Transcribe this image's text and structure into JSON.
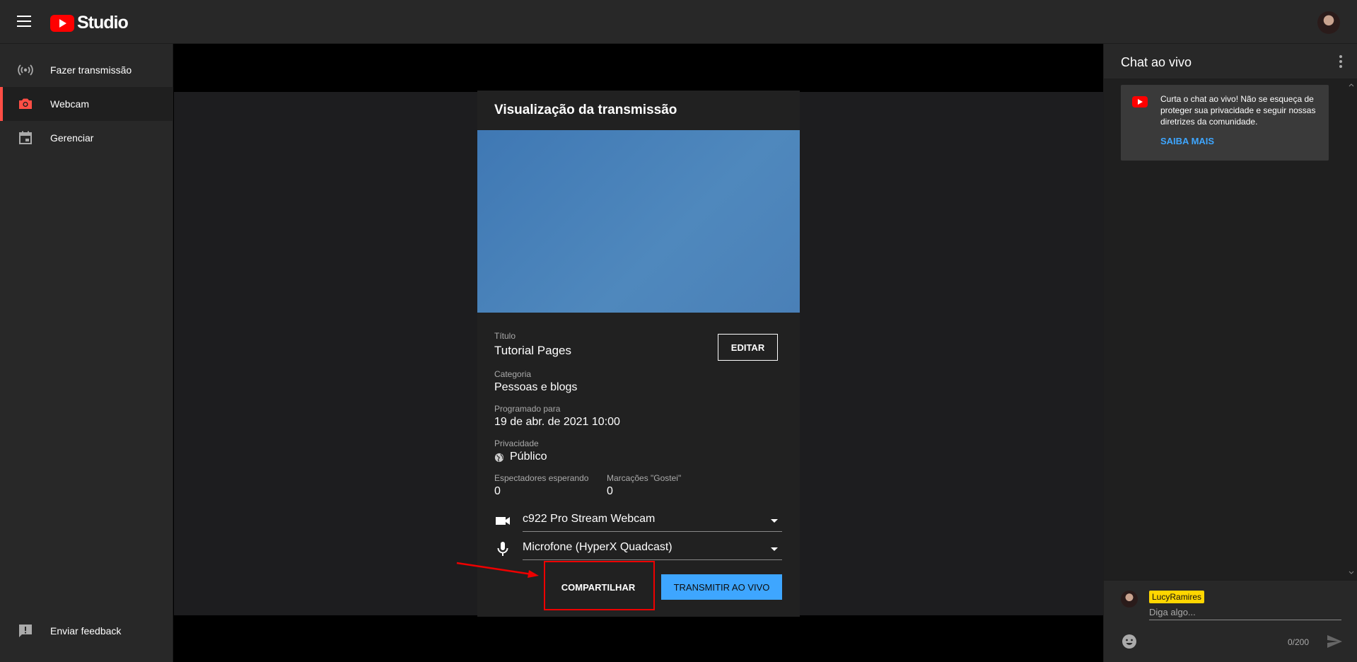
{
  "header": {
    "logo_text": "Studio"
  },
  "sidebar": {
    "items": [
      {
        "label": "Fazer transmissão",
        "icon": "broadcast-icon"
      },
      {
        "label": "Webcam",
        "icon": "camera-icon",
        "active": true
      },
      {
        "label": "Gerenciar",
        "icon": "calendar-icon"
      }
    ],
    "feedback_label": "Enviar feedback"
  },
  "preview": {
    "title": "Visualização da transmissão",
    "edit_label": "EDITAR",
    "titulo_label": "Título",
    "titulo_value": "Tutorial Pages",
    "categoria_label": "Categoria",
    "categoria_value": "Pessoas e blogs",
    "programado_label": "Programado para",
    "programado_value": "19 de abr. de 2021 10:00",
    "privacidade_label": "Privacidade",
    "privacidade_value": "Público",
    "espectadores_label": "Espectadores esperando",
    "espectadores_value": "0",
    "gostei_label": "Marcações \"Gostei\"",
    "gostei_value": "0",
    "camera_value": "c922 Pro Stream Webcam",
    "mic_value": "Microfone (HyperX Quadcast)",
    "share_label": "COMPARTILHAR",
    "live_label": "TRANSMITIR AO VIVO"
  },
  "chat": {
    "title": "Chat ao vivo",
    "notice_text": "Curta o chat ao vivo! Não se esqueça de proteger sua privacidade e seguir nossas diretrizes da comunidade.",
    "notice_link": "SAIBA MAIS",
    "username": "LucyRamires",
    "input_placeholder": "Diga algo...",
    "counter": "0/200"
  },
  "colors": {
    "accent_red": "#ff0000",
    "active_bar": "#ff4e45",
    "link_blue": "#3ea6ff",
    "highlight": "#e00000",
    "username_badge": "#ffd600"
  }
}
